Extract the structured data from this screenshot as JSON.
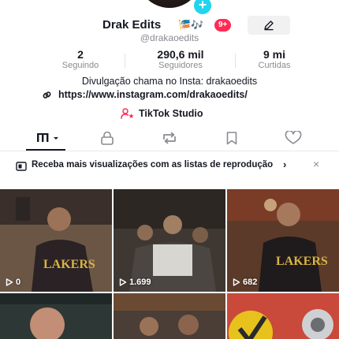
{
  "profile": {
    "username": "Drak Edits",
    "emoji": "🎏🎶",
    "notification_badge": "9+",
    "handle": "@drakaoedits",
    "stats": [
      {
        "value": "2",
        "label": "Seguindo"
      },
      {
        "value": "290,6 mil",
        "label": "Seguidores"
      },
      {
        "value": "9 mi",
        "label": "Curtidas"
      }
    ],
    "bio": "Divulgação chama no Insta: drakaoedits",
    "link": "https://www.instagram.com/drakaoedits/",
    "studio_label": "TikTok Studio"
  },
  "tabs": [
    {
      "icon": "grid-icon",
      "active": true
    },
    {
      "icon": "lock-icon",
      "active": false
    },
    {
      "icon": "repost-icon",
      "active": false
    },
    {
      "icon": "bookmark-icon",
      "active": false
    },
    {
      "icon": "heart-icon",
      "active": false
    }
  ],
  "banner": {
    "text": "Receba mais visualizações com as listas de reprodução",
    "chevron": "›",
    "close": "×"
  },
  "videos": [
    {
      "views": "0"
    },
    {
      "views": "1.699"
    },
    {
      "views": "682"
    },
    {
      "views": ""
    },
    {
      "views": ""
    },
    {
      "views": ""
    }
  ],
  "colors": {
    "accent_red": "#fe2c55",
    "accent_cyan": "#20d5ec",
    "text_primary": "#161823",
    "text_secondary": "#8a8b91"
  }
}
